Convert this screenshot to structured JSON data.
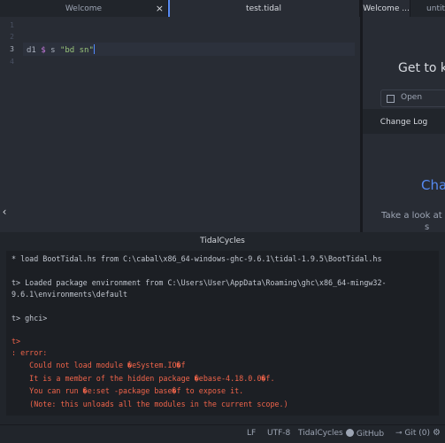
{
  "tabs": [
    {
      "label": "Welcome"
    },
    {
      "label": "test.tidal"
    },
    {
      "label": "Welcome ..."
    },
    {
      "label": "untit"
    }
  ],
  "editor": {
    "line_numbers": [
      "1",
      "2",
      "3",
      "4"
    ],
    "code": {
      "ident": "d1",
      "op": "$",
      "fn": "s",
      "str": "\"bd sn\""
    }
  },
  "welcome": {
    "heading": "Get to k",
    "item": "Open",
    "changelog_tab": "Change Log",
    "changelog_heading": "Cha",
    "changelog_text1": "Take a look at s",
    "changelog_text2": "s"
  },
  "panel": {
    "title": "TidalCycles"
  },
  "console_lines": [
    {
      "text": "* load BootTidal.hs from C:\\cabal\\x86_64-windows-ghc-9.6.1\\tidal-1.9.5\\BootTidal.hs",
      "error": false
    },
    {
      "text": "t> Loaded package environment from C:\\Users\\User\\AppData\\Roaming\\ghc\\x86_64-mingw32-",
      "error": false
    },
    {
      "text": "9.6.1\\environments\\default",
      "error": false
    },
    {
      "text": "t> ghci>",
      "error": false
    },
    {
      "text": "t>",
      "error": true
    },
    {
      "text": ": error:",
      "error": true
    },
    {
      "text": "    Could not load module �eSystem.IO�f",
      "error": true
    },
    {
      "text": "    It is a member of the hidden package �ebase-4.18.0.0�f.",
      "error": true
    },
    {
      "text": "    You can run �e:set -package base�f to expose it.",
      "error": true
    },
    {
      "text": "    (Note: this unloads all the modules in the current scope.)",
      "error": true
    }
  ],
  "status": {
    "line_ending": "LF",
    "encoding": "UTF-8",
    "grammar": "TidalCycles",
    "github": "GitHub",
    "git": "Git (0)"
  },
  "colors": {
    "accent": "#568af2",
    "error": "#f0644a",
    "string": "#98c379"
  }
}
